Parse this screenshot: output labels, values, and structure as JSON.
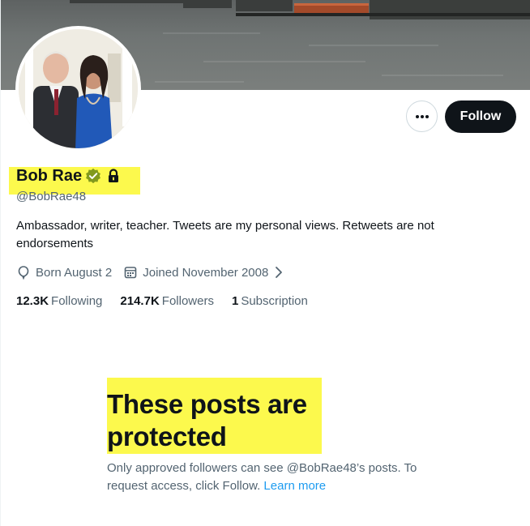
{
  "profile": {
    "name": "Bob Rae",
    "handle": "@BobRae48",
    "bio": "Ambassador, writer, teacher. Tweets are my personal views. Retweets are not endorsements",
    "born": "Born August 2",
    "joined": "Joined November 2008",
    "following_count": "12.3K",
    "following_label": "Following",
    "followers_count": "214.7K",
    "followers_label": "Followers",
    "subscription_count": "1",
    "subscription_label": "Subscription"
  },
  "actions": {
    "more_icon": "more-horizontal-icon",
    "follow_label": "Follow"
  },
  "protected": {
    "title": "These posts are protected",
    "text": "Only approved followers can see @BobRae48’s posts. To request access, click Follow.",
    "learn_more": "Learn more"
  },
  "icons": {
    "verified": "verified-badge-icon",
    "lock": "lock-icon",
    "born": "balloon-icon",
    "joined": "calendar-icon",
    "chevron": "chevron-right-icon"
  },
  "colors": {
    "highlight": "#fcf94d",
    "verified": "#829a1d",
    "link": "#1d9bf0",
    "follow_bg": "#0f1419",
    "secondary_text": "#536471"
  }
}
